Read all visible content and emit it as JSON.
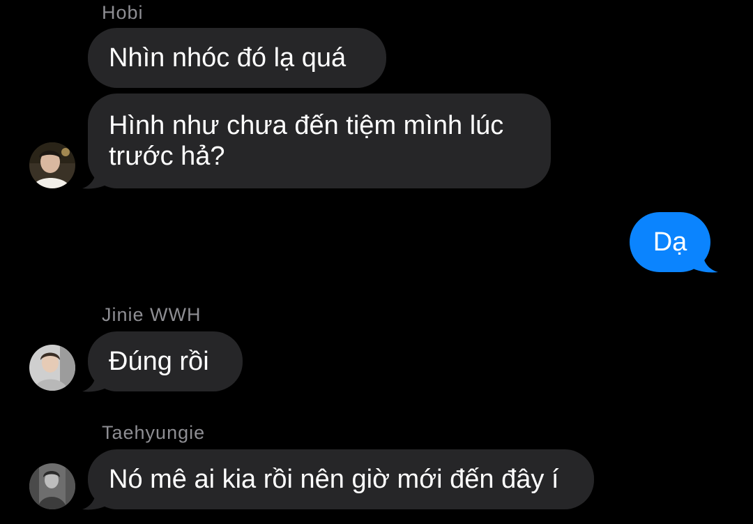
{
  "conversation": {
    "messages": [
      {
        "sender": "Hobi",
        "text": "Nhìn nhóc đó lạ quá"
      },
      {
        "text_line1": "Hình như chưa đến tiệm mình lúc",
        "text_line2": "trước hả?",
        "avatar": "hobi-avatar"
      },
      {
        "text": "Dạ",
        "direction": "outgoing"
      },
      {
        "sender": "Jinie WWH",
        "text": "Đúng rồi",
        "avatar": "jinie-avatar"
      },
      {
        "sender": "Taehyungie",
        "text": "Nó mê ai kia rồi nên giờ mới đến đây í",
        "avatar": "taehyungie-avatar"
      }
    ]
  },
  "colors": {
    "background": "#000000",
    "incoming_bubble": "#262628",
    "outgoing_bubble": "#0b84fe",
    "sender_name": "#8e8e93",
    "text": "#ffffff"
  }
}
